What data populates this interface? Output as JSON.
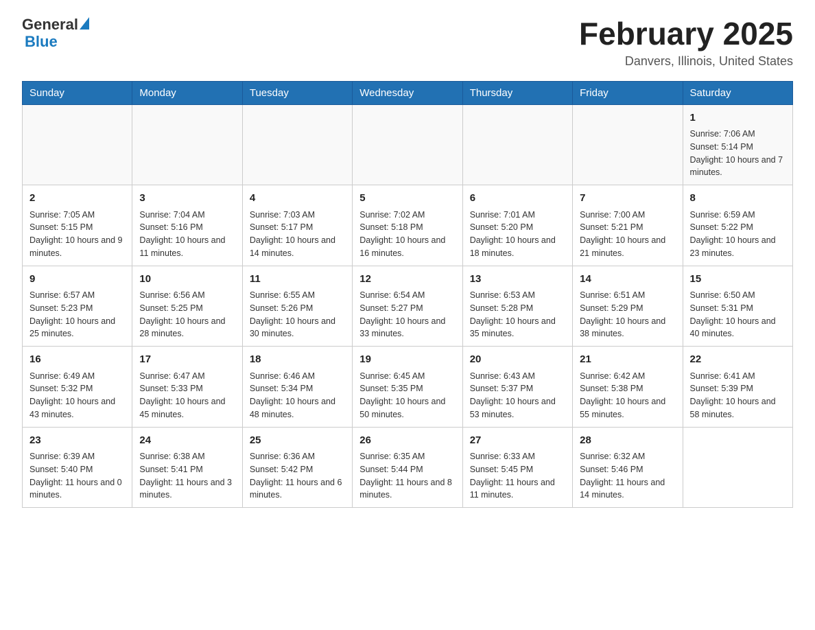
{
  "logo": {
    "general": "General",
    "blue": "Blue"
  },
  "title": {
    "month": "February 2025",
    "location": "Danvers, Illinois, United States"
  },
  "days_of_week": [
    "Sunday",
    "Monday",
    "Tuesday",
    "Wednesday",
    "Thursday",
    "Friday",
    "Saturday"
  ],
  "weeks": [
    [
      {
        "day": "",
        "info": ""
      },
      {
        "day": "",
        "info": ""
      },
      {
        "day": "",
        "info": ""
      },
      {
        "day": "",
        "info": ""
      },
      {
        "day": "",
        "info": ""
      },
      {
        "day": "",
        "info": ""
      },
      {
        "day": "1",
        "info": "Sunrise: 7:06 AM\nSunset: 5:14 PM\nDaylight: 10 hours and 7 minutes."
      }
    ],
    [
      {
        "day": "2",
        "info": "Sunrise: 7:05 AM\nSunset: 5:15 PM\nDaylight: 10 hours and 9 minutes."
      },
      {
        "day": "3",
        "info": "Sunrise: 7:04 AM\nSunset: 5:16 PM\nDaylight: 10 hours and 11 minutes."
      },
      {
        "day": "4",
        "info": "Sunrise: 7:03 AM\nSunset: 5:17 PM\nDaylight: 10 hours and 14 minutes."
      },
      {
        "day": "5",
        "info": "Sunrise: 7:02 AM\nSunset: 5:18 PM\nDaylight: 10 hours and 16 minutes."
      },
      {
        "day": "6",
        "info": "Sunrise: 7:01 AM\nSunset: 5:20 PM\nDaylight: 10 hours and 18 minutes."
      },
      {
        "day": "7",
        "info": "Sunrise: 7:00 AM\nSunset: 5:21 PM\nDaylight: 10 hours and 21 minutes."
      },
      {
        "day": "8",
        "info": "Sunrise: 6:59 AM\nSunset: 5:22 PM\nDaylight: 10 hours and 23 minutes."
      }
    ],
    [
      {
        "day": "9",
        "info": "Sunrise: 6:57 AM\nSunset: 5:23 PM\nDaylight: 10 hours and 25 minutes."
      },
      {
        "day": "10",
        "info": "Sunrise: 6:56 AM\nSunset: 5:25 PM\nDaylight: 10 hours and 28 minutes."
      },
      {
        "day": "11",
        "info": "Sunrise: 6:55 AM\nSunset: 5:26 PM\nDaylight: 10 hours and 30 minutes."
      },
      {
        "day": "12",
        "info": "Sunrise: 6:54 AM\nSunset: 5:27 PM\nDaylight: 10 hours and 33 minutes."
      },
      {
        "day": "13",
        "info": "Sunrise: 6:53 AM\nSunset: 5:28 PM\nDaylight: 10 hours and 35 minutes."
      },
      {
        "day": "14",
        "info": "Sunrise: 6:51 AM\nSunset: 5:29 PM\nDaylight: 10 hours and 38 minutes."
      },
      {
        "day": "15",
        "info": "Sunrise: 6:50 AM\nSunset: 5:31 PM\nDaylight: 10 hours and 40 minutes."
      }
    ],
    [
      {
        "day": "16",
        "info": "Sunrise: 6:49 AM\nSunset: 5:32 PM\nDaylight: 10 hours and 43 minutes."
      },
      {
        "day": "17",
        "info": "Sunrise: 6:47 AM\nSunset: 5:33 PM\nDaylight: 10 hours and 45 minutes."
      },
      {
        "day": "18",
        "info": "Sunrise: 6:46 AM\nSunset: 5:34 PM\nDaylight: 10 hours and 48 minutes."
      },
      {
        "day": "19",
        "info": "Sunrise: 6:45 AM\nSunset: 5:35 PM\nDaylight: 10 hours and 50 minutes."
      },
      {
        "day": "20",
        "info": "Sunrise: 6:43 AM\nSunset: 5:37 PM\nDaylight: 10 hours and 53 minutes."
      },
      {
        "day": "21",
        "info": "Sunrise: 6:42 AM\nSunset: 5:38 PM\nDaylight: 10 hours and 55 minutes."
      },
      {
        "day": "22",
        "info": "Sunrise: 6:41 AM\nSunset: 5:39 PM\nDaylight: 10 hours and 58 minutes."
      }
    ],
    [
      {
        "day": "23",
        "info": "Sunrise: 6:39 AM\nSunset: 5:40 PM\nDaylight: 11 hours and 0 minutes."
      },
      {
        "day": "24",
        "info": "Sunrise: 6:38 AM\nSunset: 5:41 PM\nDaylight: 11 hours and 3 minutes."
      },
      {
        "day": "25",
        "info": "Sunrise: 6:36 AM\nSunset: 5:42 PM\nDaylight: 11 hours and 6 minutes."
      },
      {
        "day": "26",
        "info": "Sunrise: 6:35 AM\nSunset: 5:44 PM\nDaylight: 11 hours and 8 minutes."
      },
      {
        "day": "27",
        "info": "Sunrise: 6:33 AM\nSunset: 5:45 PM\nDaylight: 11 hours and 11 minutes."
      },
      {
        "day": "28",
        "info": "Sunrise: 6:32 AM\nSunset: 5:46 PM\nDaylight: 11 hours and 14 minutes."
      },
      {
        "day": "",
        "info": ""
      }
    ]
  ]
}
